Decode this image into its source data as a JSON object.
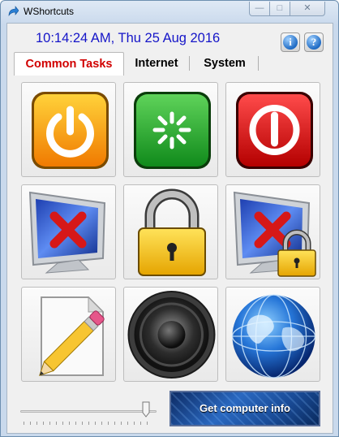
{
  "window": {
    "title": "WShortcuts"
  },
  "window_controls": {
    "minimize": "—",
    "maximize": "□",
    "close": "✕"
  },
  "clock": {
    "text": "10:14:24 AM, Thu 25 Aug 2016",
    "color": "#1515c8"
  },
  "header_buttons": {
    "info_glyph": "i",
    "help_glyph": "?"
  },
  "tabs": [
    {
      "label": "Common Tasks",
      "active": true
    },
    {
      "label": "Internet",
      "active": false
    },
    {
      "label": "System",
      "active": false
    }
  ],
  "tiles": [
    {
      "icon": "power-icon"
    },
    {
      "icon": "restart-icon"
    },
    {
      "icon": "shutdown-icon"
    },
    {
      "icon": "monitor-off-icon"
    },
    {
      "icon": "padlock-icon"
    },
    {
      "icon": "monitor-lock-icon"
    },
    {
      "icon": "notepad-pencil-icon"
    },
    {
      "icon": "speaker-icon"
    },
    {
      "icon": "globe-icon"
    }
  ],
  "slider": {
    "value_fraction": 0.95
  },
  "info_button": {
    "label": "Get computer info"
  },
  "colors": {
    "active_tab": "#d10000",
    "window_frame": "#c9d9ec"
  }
}
